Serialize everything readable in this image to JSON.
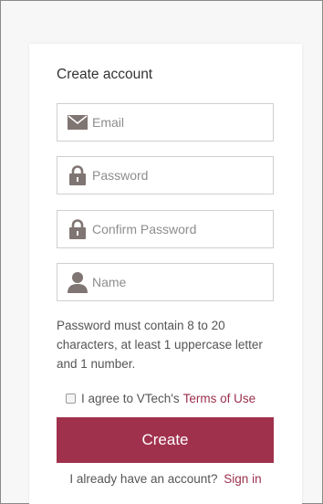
{
  "form": {
    "title": "Create account",
    "email": {
      "placeholder": "Email",
      "value": ""
    },
    "password": {
      "placeholder": "Password",
      "value": ""
    },
    "confirm_password": {
      "placeholder": "Confirm Password",
      "value": ""
    },
    "name": {
      "placeholder": "Name",
      "value": ""
    },
    "hint": "Password must contain 8 to 20 characters, at least 1 uppercase letter and 1 number.",
    "agree_text": "I agree to VTech's",
    "terms_link": "Terms of Use",
    "agree_checked": false,
    "create_label": "Create",
    "signin_text": "I already have an account?",
    "signin_link": "Sign in"
  },
  "colors": {
    "accent": "#a0314d",
    "link": "#9a2f4d",
    "icon": "#7f7573"
  },
  "icons": {
    "email": "envelope-icon",
    "password": "lock-icon",
    "confirm_password": "lock-icon",
    "name": "user-icon"
  }
}
